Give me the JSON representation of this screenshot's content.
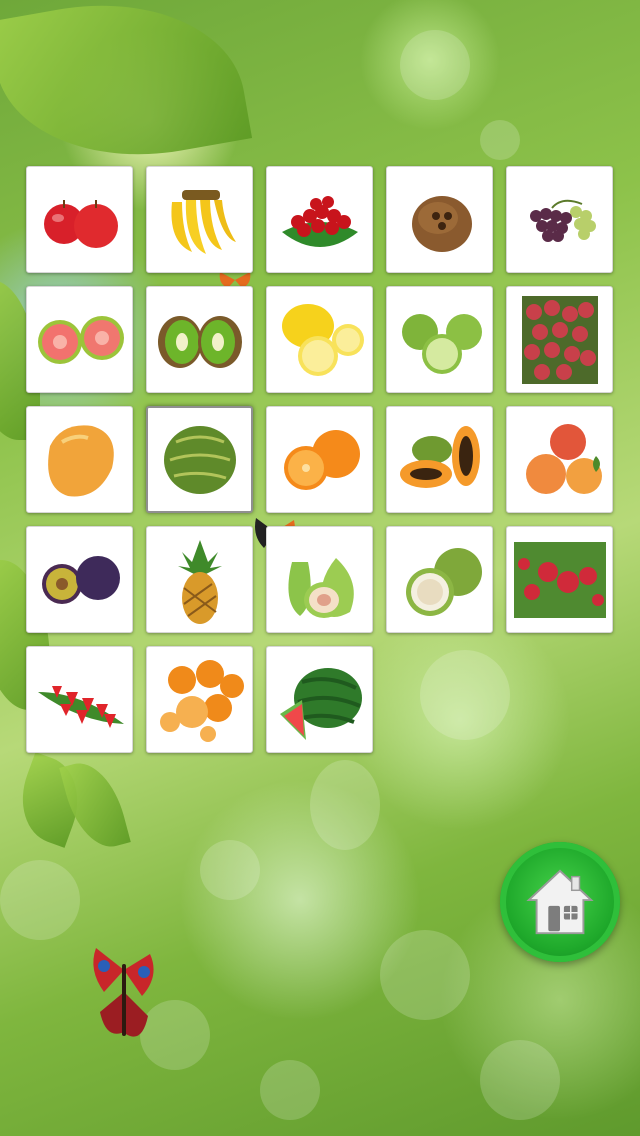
{
  "screen": {
    "name": "Fruits"
  },
  "fruits": [
    {
      "name": "apple"
    },
    {
      "name": "banana"
    },
    {
      "name": "cherry"
    },
    {
      "name": "coconut"
    },
    {
      "name": "grapes"
    },
    {
      "name": "guava"
    },
    {
      "name": "kiwi"
    },
    {
      "name": "lemon"
    },
    {
      "name": "lime"
    },
    {
      "name": "lychee"
    },
    {
      "name": "mango"
    },
    {
      "name": "melon"
    },
    {
      "name": "orange"
    },
    {
      "name": "papaya"
    },
    {
      "name": "peach"
    },
    {
      "name": "plum"
    },
    {
      "name": "pineapple"
    },
    {
      "name": "fig"
    },
    {
      "name": "pomelo"
    },
    {
      "name": "raspberry"
    },
    {
      "name": "strawberry"
    },
    {
      "name": "tangerine"
    },
    {
      "name": "watermelon"
    }
  ],
  "selected_fruit": "melon",
  "home_button": {
    "icon": "home-icon"
  },
  "colors": {
    "background": "#8dc24a",
    "home_button": "#1fa92b",
    "tile": "#ffffff"
  }
}
